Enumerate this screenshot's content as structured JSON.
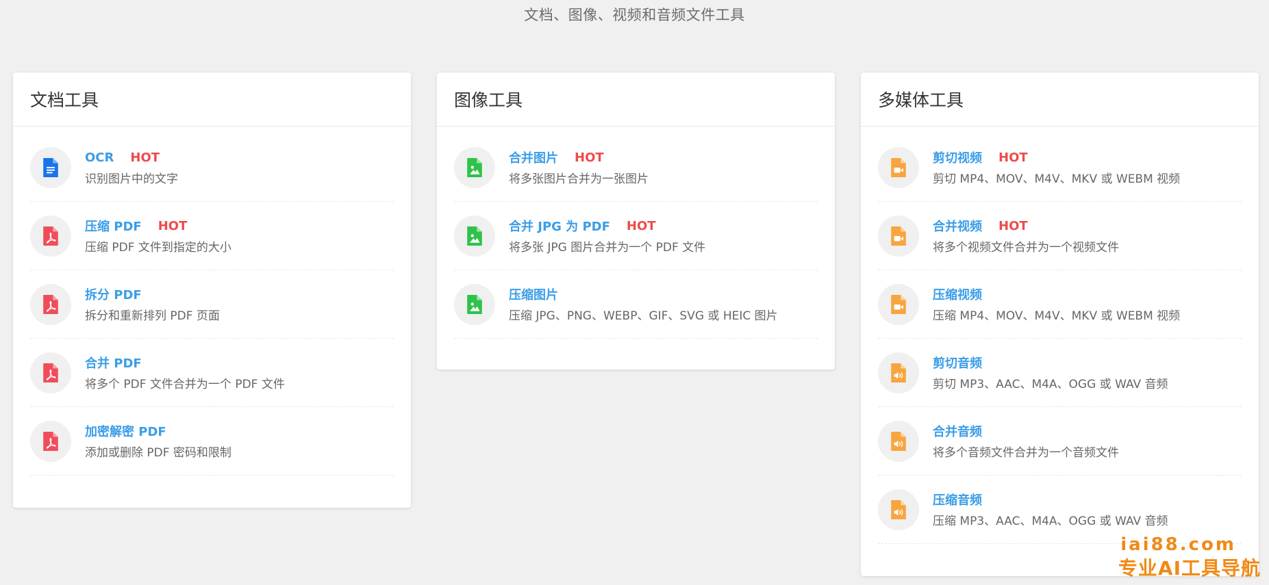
{
  "page": {
    "subtitle": "文档、图像、视频和音频文件工具"
  },
  "colors": {
    "background": "#f0f0f0",
    "link": "#3a9de8",
    "hot": "#ef4a4a",
    "doc_icon": "#1a73e8",
    "pdf_icon": "#ef4d5a",
    "image_icon": "#2fc24a",
    "media_icon": "#f7a53e",
    "watermark": "#f08a16"
  },
  "cards": {
    "docs": {
      "title": "文档工具",
      "tools": [
        {
          "name": "OCR",
          "hot": "HOT",
          "desc": "识别图片中的文字",
          "icon": "google-doc-icon"
        },
        {
          "name": "压缩 PDF",
          "hot": "HOT",
          "desc": "压缩 PDF 文件到指定的大小",
          "icon": "pdf-file-icon"
        },
        {
          "name": "拆分 PDF",
          "hot": "",
          "desc": "拆分和重新排列 PDF 页面",
          "icon": "pdf-file-icon"
        },
        {
          "name": "合并 PDF",
          "hot": "",
          "desc": "将多个 PDF 文件合并为一个 PDF 文件",
          "icon": "pdf-file-icon"
        },
        {
          "name": "加密解密 PDF",
          "hot": "",
          "desc": "添加或删除 PDF 密码和限制",
          "icon": "pdf-file-icon"
        }
      ]
    },
    "images": {
      "title": "图像工具",
      "tools": [
        {
          "name": "合并图片",
          "hot": "HOT",
          "desc": "将多张图片合并为一张图片",
          "icon": "image-file-icon"
        },
        {
          "name": "合并 JPG 为 PDF",
          "hot": "HOT",
          "desc": "将多张 JPG 图片合并为一个 PDF 文件",
          "icon": "image-file-icon"
        },
        {
          "name": "压缩图片",
          "hot": "",
          "desc": "压缩 JPG、PNG、WEBP、GIF、SVG 或 HEIC 图片",
          "icon": "image-file-icon"
        }
      ]
    },
    "media": {
      "title": "多媒体工具",
      "tools": [
        {
          "name": "剪切视频",
          "hot": "HOT",
          "desc": "剪切 MP4、MOV、M4V、MKV 或 WEBM 视频",
          "icon": "video-file-icon"
        },
        {
          "name": "合并视频",
          "hot": "HOT",
          "desc": "将多个视频文件合并为一个视频文件",
          "icon": "video-file-icon"
        },
        {
          "name": "压缩视频",
          "hot": "",
          "desc": "压缩 MP4、MOV、M4V、MKV 或 WEBM 视频",
          "icon": "video-file-icon"
        },
        {
          "name": "剪切音频",
          "hot": "",
          "desc": "剪切 MP3、AAC、M4A、OGG 或 WAV 音频",
          "icon": "audio-file-icon"
        },
        {
          "name": "合并音频",
          "hot": "",
          "desc": "将多个音频文件合并为一个音频文件",
          "icon": "audio-file-icon"
        },
        {
          "name": "压缩音频",
          "hot": "",
          "desc": "压缩 MP3、AAC、M4A、OGG 或 WAV 音频",
          "icon": "audio-file-icon"
        }
      ]
    }
  },
  "watermark": {
    "url": "iai88.com",
    "slogan": "专业AI工具导航"
  }
}
